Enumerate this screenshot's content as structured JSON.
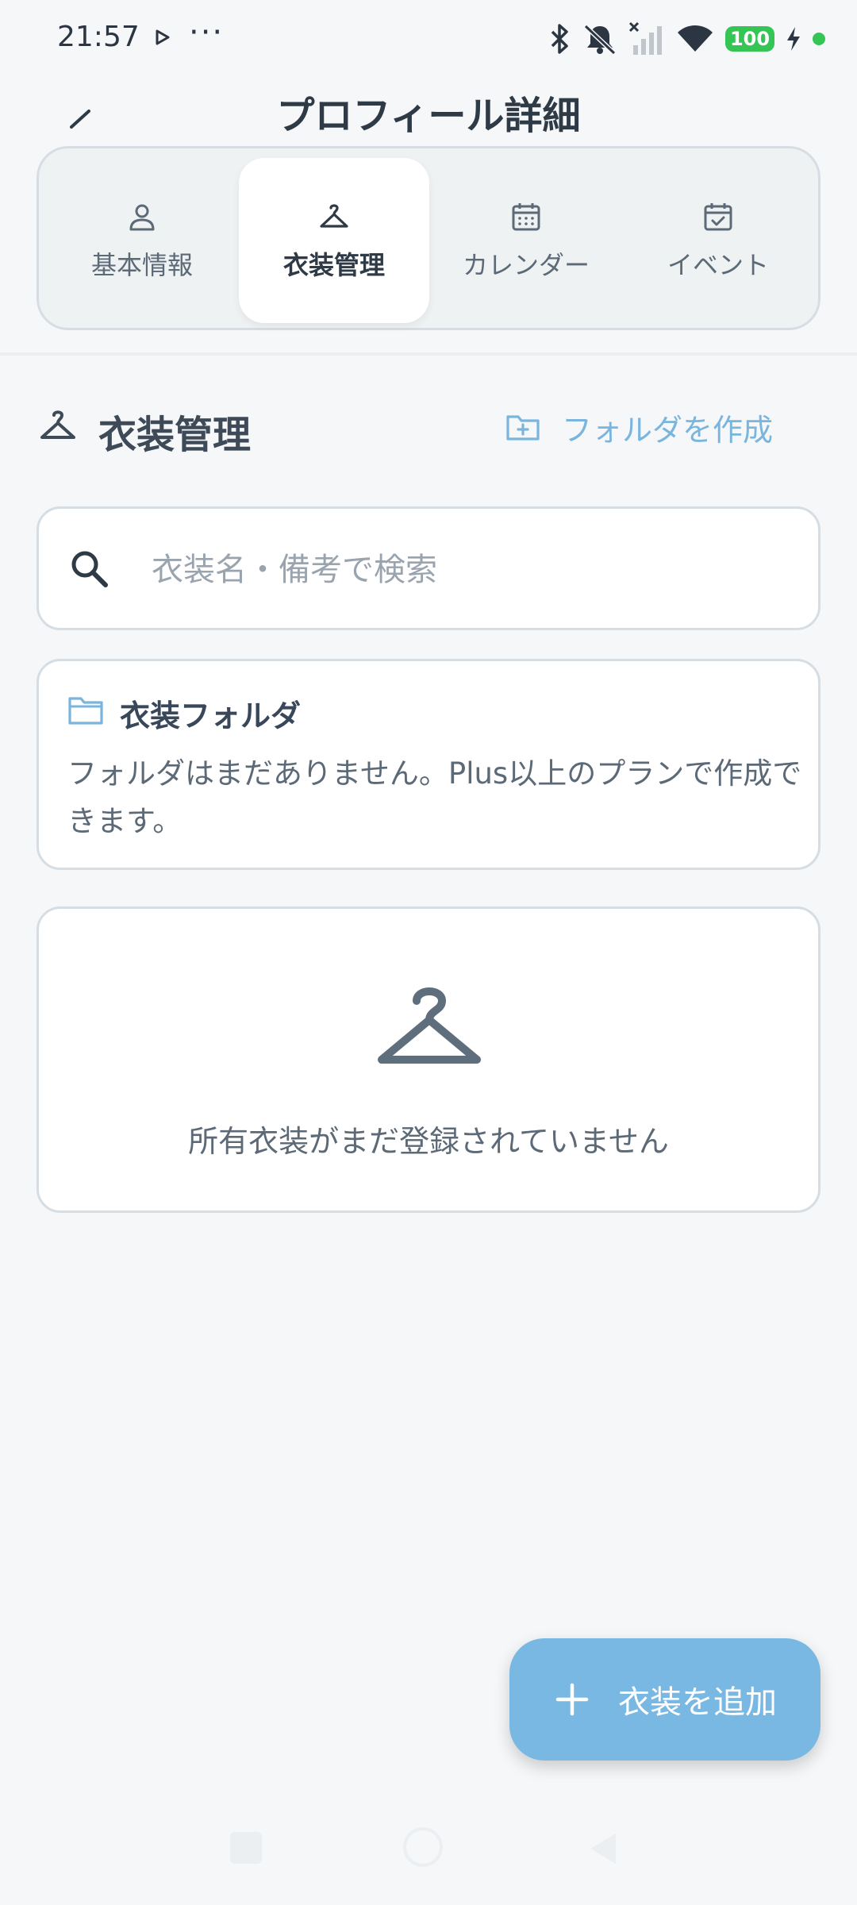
{
  "status_bar": {
    "time": "21:57",
    "dots": "···",
    "battery": "100",
    "icons": [
      "play-icon",
      "bluetooth-icon",
      "bell-off-icon",
      "no-signal-icon",
      "wifi-icon",
      "battery-icon",
      "charging-icon",
      "dot-indicator"
    ]
  },
  "header": {
    "title": "プロフィール詳細",
    "edit_icon": "edit-icon"
  },
  "tabs": [
    {
      "label": "基本情報",
      "icon": "person-icon",
      "active": false
    },
    {
      "label": "衣装管理",
      "icon": "hanger-icon",
      "active": true
    },
    {
      "label": "カレンダー",
      "icon": "calendar-icon",
      "active": false
    },
    {
      "label": "イベント",
      "icon": "calendar-check-icon",
      "active": false
    }
  ],
  "section": {
    "title": "衣装管理",
    "icon": "hanger-icon",
    "create_folder_label": "フォルダを作成",
    "create_folder_icon": "folder-plus-icon"
  },
  "search": {
    "placeholder": "衣装名・備考で検索",
    "value": ""
  },
  "folder_card": {
    "title": "衣装フォルダ",
    "text": "フォルダはまだありません。Plus以上のプランで作成できます。"
  },
  "empty_state": {
    "text": "所有衣装がまだ登録されていません"
  },
  "fab": {
    "label": "衣装を追加",
    "icon": "plus-icon"
  },
  "colors": {
    "accent": "#7ab8e4",
    "text_primary": "#2f3a47",
    "text_secondary": "#5c6977",
    "border": "#d6dde3",
    "background": "#f5f7f9",
    "battery": "#35c555"
  }
}
